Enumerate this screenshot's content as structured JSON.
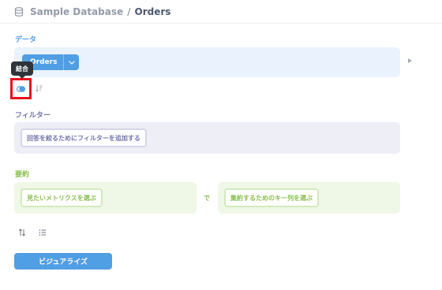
{
  "breadcrumb": {
    "database": "Sample Database",
    "separator": "/",
    "table": "Orders"
  },
  "data_section": {
    "title": "データ",
    "table_label": "Orders",
    "tooltip": "結合",
    "icons": [
      "database-icon",
      "chevron-down-icon",
      "play-arrow-icon",
      "join-icon",
      "sort-icon"
    ]
  },
  "filter_section": {
    "title": "フィルター",
    "add_filter_label": "回答を絞るためにフィルターを追加する"
  },
  "summary_section": {
    "title": "要約",
    "metric_label": "見たいメトリクスを選ぶ",
    "by_label": "で",
    "group_label": "集約するためのキー列を選ぶ"
  },
  "bottom_actions": {
    "icons": [
      "sort-arrows-icon",
      "limit-list-icon"
    ],
    "visualize_label": "ビジュアライズ"
  },
  "colors": {
    "data_accent": "#509ee3",
    "filter_accent": "#7172ad",
    "summary_accent": "#88bf4d",
    "highlight": "#e8131c"
  }
}
